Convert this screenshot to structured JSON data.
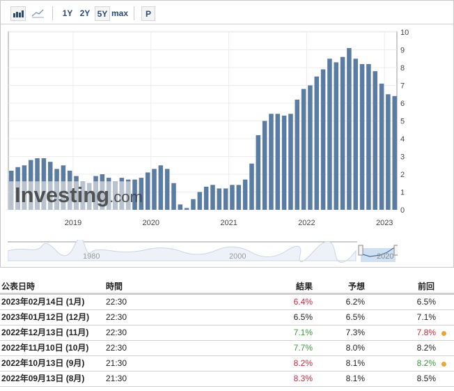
{
  "toolbar": {
    "bar_chart_icon": "bar-chart-icon",
    "line_chart_icon": "line-chart-icon",
    "ranges": [
      "1Y",
      "2Y",
      "5Y",
      "max"
    ],
    "active_range": "5Y",
    "p_label": "P"
  },
  "colors": {
    "bar": "#5a7ca3",
    "watermark_bar": "#b8c3cf",
    "red": "#c8283e",
    "green": "#3a9a3a",
    "dot": "#e8a838"
  },
  "watermark": "Investing.com",
  "chart_data": {
    "type": "bar",
    "title": "",
    "xlabel": "",
    "ylabel": "",
    "ylim": [
      0,
      10
    ],
    "yticks": [
      0,
      1,
      2,
      3,
      4,
      5,
      6,
      7,
      8,
      9,
      10
    ],
    "xtick_labels": [
      "2019",
      "2020",
      "2021",
      "2022",
      "2023"
    ],
    "values": [
      2.2,
      2.4,
      2.5,
      2.8,
      2.9,
      2.9,
      2.7,
      2.3,
      2.5,
      2.2,
      1.9,
      1.6,
      1.5,
      1.9,
      2.0,
      1.8,
      1.6,
      1.8,
      1.7,
      1.7,
      1.8,
      2.1,
      2.3,
      2.5,
      2.3,
      1.5,
      0.3,
      0.1,
      0.6,
      1.0,
      1.3,
      1.4,
      1.2,
      1.2,
      1.4,
      1.4,
      1.7,
      2.6,
      4.2,
      5.0,
      5.4,
      5.4,
      5.3,
      5.4,
      6.2,
      6.8,
      7.0,
      7.5,
      7.9,
      8.5,
      8.3,
      8.6,
      9.1,
      8.5,
      8.2,
      8.2,
      7.8,
      7.1,
      6.5,
      6.4
    ]
  },
  "navigator": {
    "labels": [
      "1980",
      "2000",
      "2020"
    ]
  },
  "table": {
    "headers": [
      "公表日時",
      "時間",
      "結果",
      "予想",
      "前回"
    ],
    "rows": [
      {
        "date": "2023年02月14日 (1月)",
        "time": "22:30",
        "actual": "6.4%",
        "actual_color": "red",
        "forecast": "6.2%",
        "previous": "6.5%",
        "previous_color": "",
        "revised": false
      },
      {
        "date": "2023年01月12日 (12月)",
        "time": "22:30",
        "actual": "6.5%",
        "actual_color": "",
        "forecast": "6.5%",
        "previous": "7.1%",
        "previous_color": "",
        "revised": false
      },
      {
        "date": "2022年12月13日 (11月)",
        "time": "22:30",
        "actual": "7.1%",
        "actual_color": "green",
        "forecast": "7.3%",
        "previous": "7.8%",
        "previous_color": "red",
        "revised": true
      },
      {
        "date": "2022年11月10日 (10月)",
        "time": "22:30",
        "actual": "7.7%",
        "actual_color": "green",
        "forecast": "8.0%",
        "previous": "8.2%",
        "previous_color": "",
        "revised": false
      },
      {
        "date": "2022年10月13日 (9月)",
        "time": "21:30",
        "actual": "8.2%",
        "actual_color": "red",
        "forecast": "8.1%",
        "previous": "8.2%",
        "previous_color": "green",
        "revised": true
      },
      {
        "date": "2022年09月13日 (8月)",
        "time": "21:30",
        "actual": "8.3%",
        "actual_color": "red",
        "forecast": "8.1%",
        "previous": "8.5%",
        "previous_color": "",
        "revised": false
      }
    ]
  }
}
